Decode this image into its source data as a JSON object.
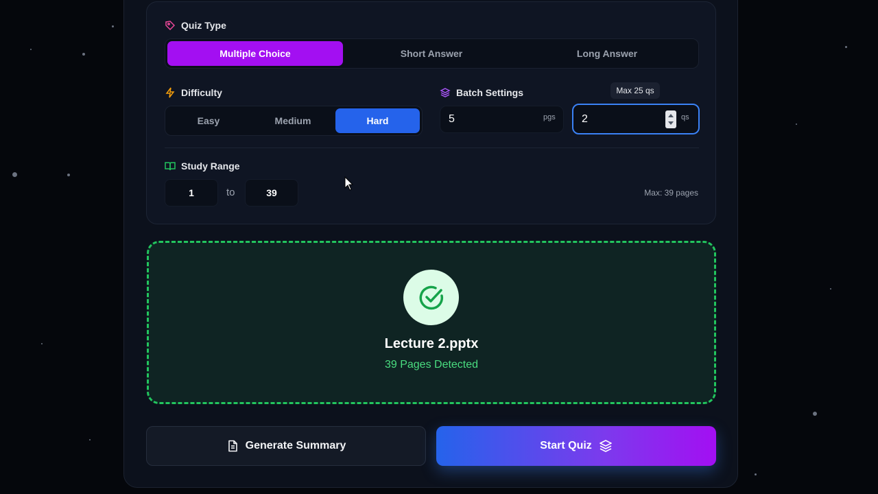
{
  "quiz_type": {
    "label": "Quiz Type",
    "options": [
      "Multiple Choice",
      "Short Answer",
      "Long Answer"
    ],
    "selected": "Multiple Choice"
  },
  "difficulty": {
    "label": "Difficulty",
    "options": [
      "Easy",
      "Medium",
      "Hard"
    ],
    "selected": "Hard"
  },
  "batch": {
    "label": "Batch Settings",
    "pages_value": "5",
    "pages_unit": "pgs",
    "questions_value": "2",
    "questions_unit": "qs",
    "tooltip": "Max 25 qs"
  },
  "study_range": {
    "label": "Study Range",
    "from": "1",
    "to_label": "to",
    "to": "39",
    "max_label": "Max: 39 pages"
  },
  "upload": {
    "file_name": "Lecture 2.pptx",
    "pages_detected": "39 Pages Detected"
  },
  "actions": {
    "summary_label": "Generate Summary",
    "start_label": "Start Quiz"
  },
  "colors": {
    "accent_purple": "#a30ff2",
    "accent_blue": "#2563eb",
    "success_green": "#22c55e"
  }
}
